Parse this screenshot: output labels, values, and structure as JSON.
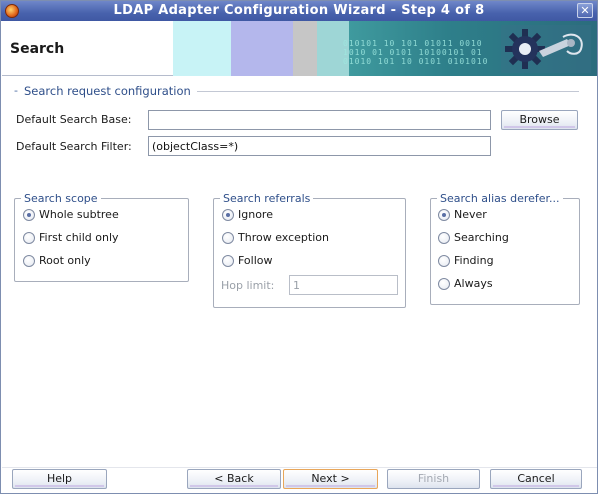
{
  "window": {
    "title": "LDAP Adapter Configuration Wizard - Step 4 of 8",
    "close_glyph": "✕"
  },
  "header": {
    "heading": "Search",
    "banner_digits": "010101 10 101 01011 0010\n1010 01 0101 10100101 01\n01010 101 10 0101 0101010"
  },
  "section": {
    "dash": "-",
    "title": "Search request configuration"
  },
  "fields": {
    "search_base": {
      "label": "Default Search Base:",
      "value": ""
    },
    "search_filter": {
      "label": "Default Search Filter:",
      "value": "(objectClass=*)"
    },
    "browse_label": "Browse"
  },
  "scope": {
    "title": "Search scope",
    "options": [
      {
        "label": "Whole subtree",
        "selected": true
      },
      {
        "label": "First child only",
        "selected": false
      },
      {
        "label": "Root only",
        "selected": false
      }
    ]
  },
  "referrals": {
    "title": "Search referrals",
    "options": [
      {
        "label": "Ignore",
        "selected": true
      },
      {
        "label": "Throw exception",
        "selected": false
      },
      {
        "label": "Follow",
        "selected": false
      }
    ],
    "hop_limit_label": "Hop limit:",
    "hop_limit_value": "1"
  },
  "alias": {
    "title": "Search alias derefer...",
    "options": [
      {
        "label": "Never",
        "selected": true
      },
      {
        "label": "Searching",
        "selected": false
      },
      {
        "label": "Finding",
        "selected": false
      },
      {
        "label": "Always",
        "selected": false
      }
    ]
  },
  "footer": {
    "help": "Help",
    "back": "< Back",
    "next": "Next >",
    "finish": "Finish",
    "cancel": "Cancel"
  },
  "colors": {
    "titlebar": "#4862ad",
    "accent_text": "#2f4f8a",
    "primary_button_border": "#e8a65a"
  }
}
